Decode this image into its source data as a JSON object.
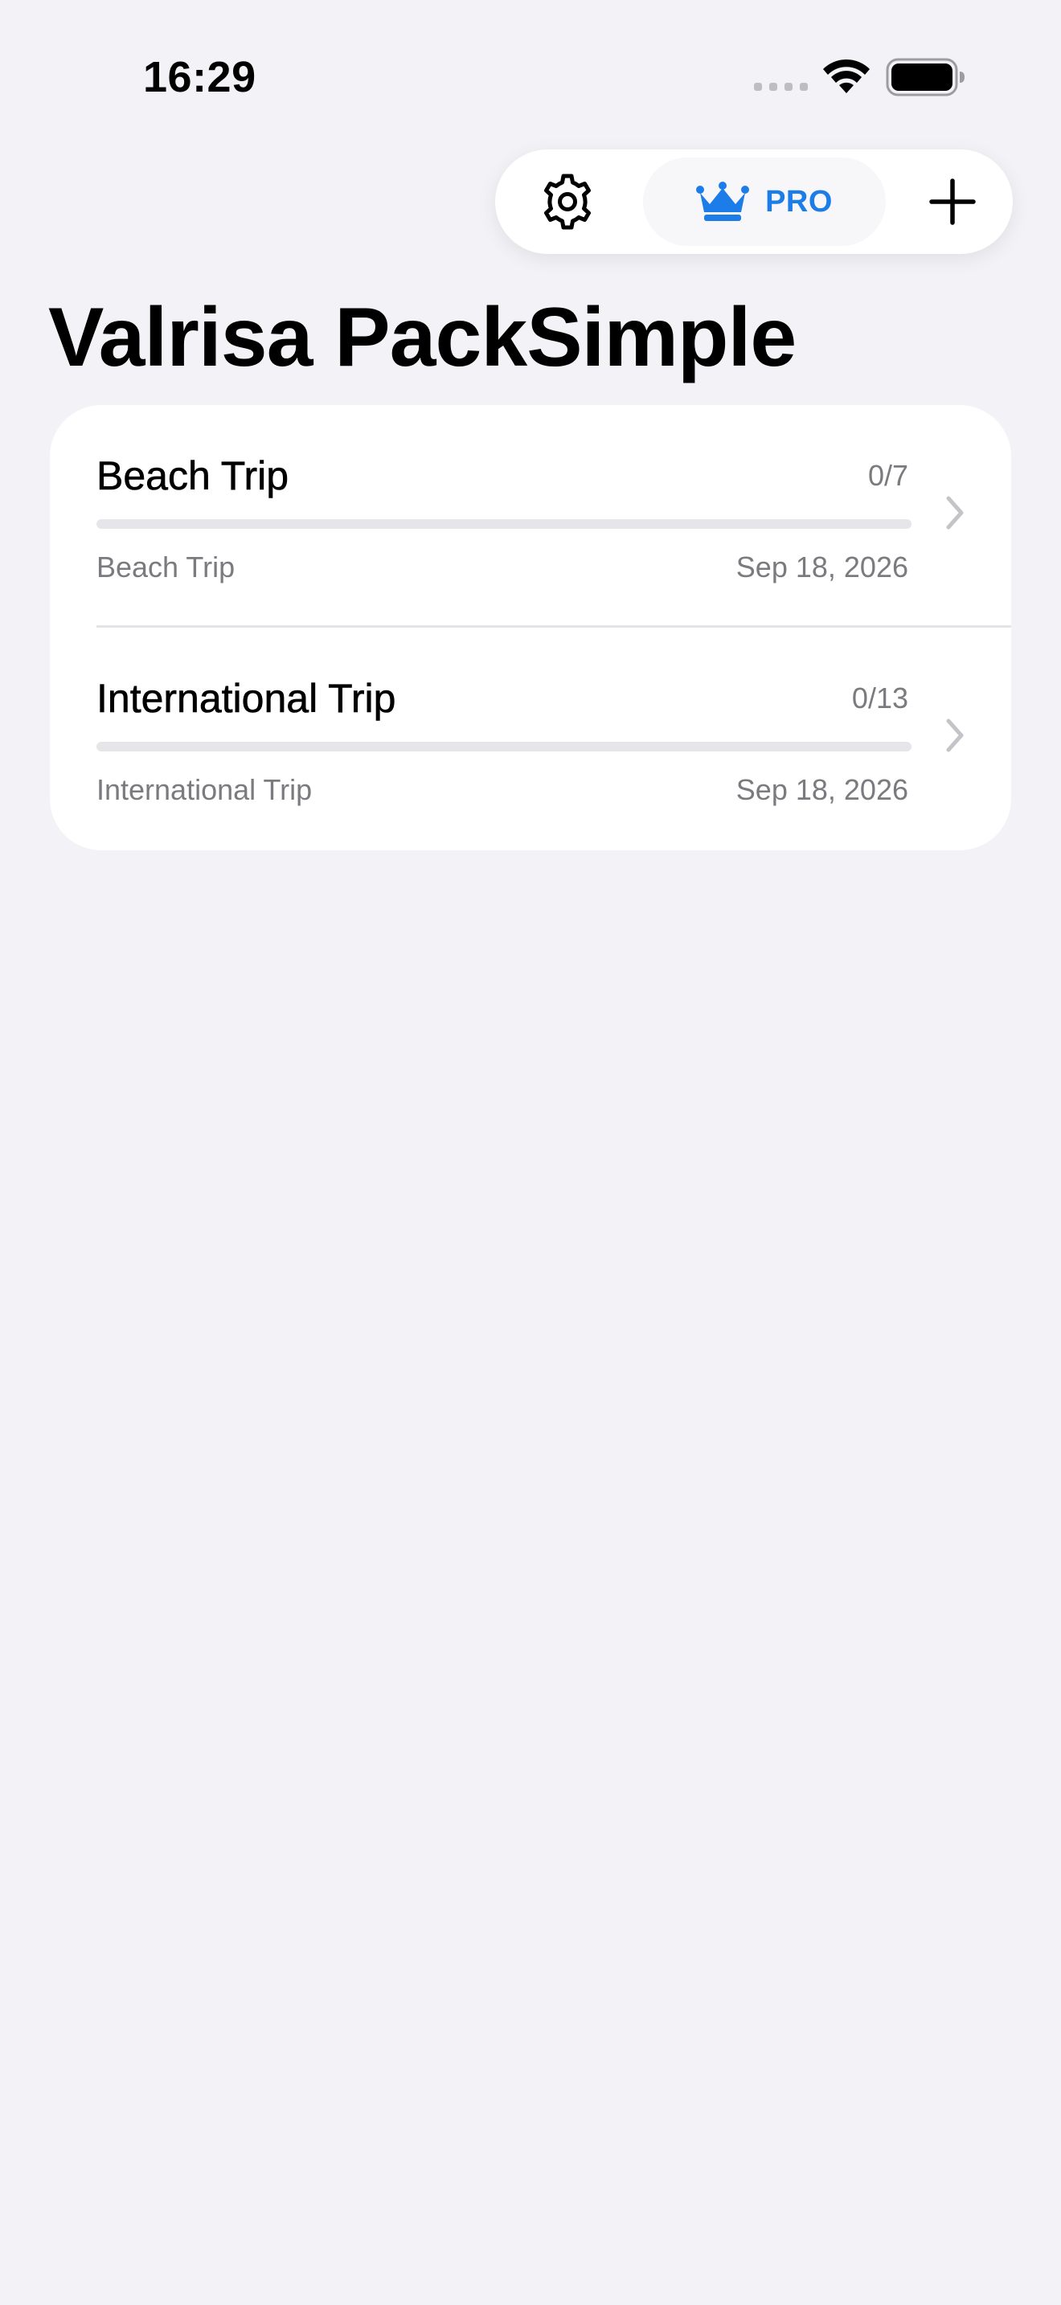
{
  "status_bar": {
    "time": "16:29"
  },
  "toolbar": {
    "settings_icon": "gear-icon",
    "pro_icon": "crown-icon",
    "pro_label": "PRO",
    "add_icon": "plus-icon",
    "accent_color": "#1C7CE8"
  },
  "page": {
    "title": "Valrisa PackSimple"
  },
  "trips": [
    {
      "name": "Beach Trip",
      "count": "0/7",
      "progress": 0,
      "subtitle": "Beach Trip",
      "date": "Sep 18, 2026"
    },
    {
      "name": "International Trip",
      "count": "0/13",
      "progress": 0,
      "subtitle": "International Trip",
      "date": "Sep 18, 2026"
    }
  ]
}
